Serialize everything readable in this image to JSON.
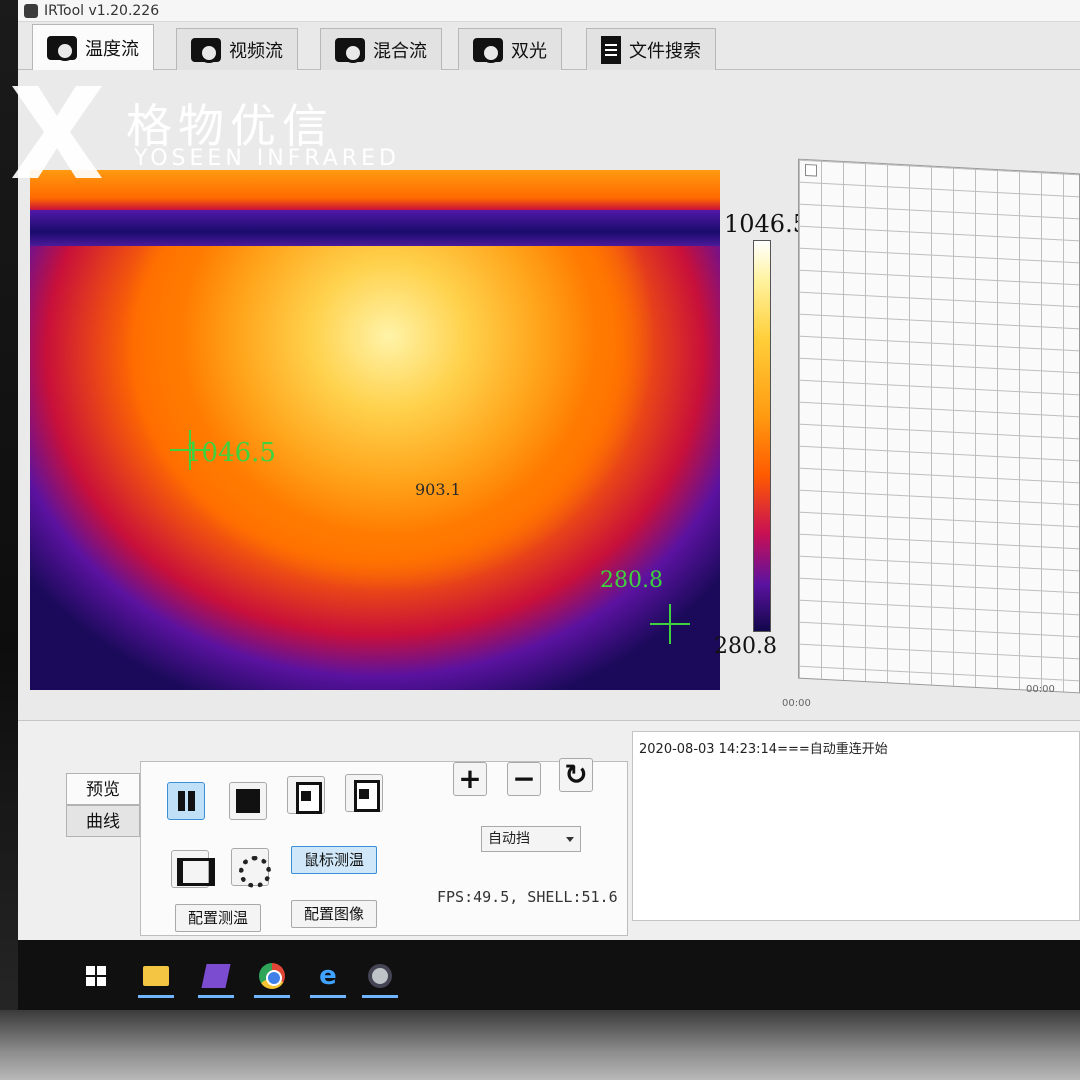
{
  "window": {
    "title": "IRTool v1.20.226"
  },
  "tabs": [
    {
      "label": "温度流",
      "icon": "camera-icon"
    },
    {
      "label": "视频流",
      "icon": "camera-icon"
    },
    {
      "label": "混合流",
      "icon": "camera-icon"
    },
    {
      "label": "双光",
      "icon": "camera-icon"
    },
    {
      "label": "文件搜索",
      "icon": "document-icon"
    }
  ],
  "watermark": {
    "brand_cn": "格物优信",
    "brand_en": "YOSEEN INFRARED"
  },
  "thermal": {
    "max_label": "1046.5",
    "center_label": "903.1",
    "min_label": "280.8",
    "colorbar_max": "1046.5",
    "colorbar_min": "280.8"
  },
  "chart": {
    "x_ticks": [
      "00:00",
      "00:00"
    ]
  },
  "side_tabs": [
    "预览",
    "曲线"
  ],
  "controls": {
    "mouse_measure_label": "鼠标测温",
    "config_measure_label": "配置测温",
    "config_image_label": "配置图像",
    "zoom_in_label": "+",
    "zoom_out_label": "−",
    "range_select_value": "自动挡",
    "status_text": "FPS:49.5, SHELL:51.6"
  },
  "log": {
    "entries": [
      "2020-08-03 14:23:14===自动重连开始"
    ]
  },
  "taskbar": {
    "items": [
      "windows-start-icon",
      "file-explorer-icon",
      "visual-studio-icon",
      "chrome-icon",
      "edge-icon",
      "irtool-app-icon"
    ],
    "accent": "#6fb4ff"
  },
  "colors": {
    "pressed_button": "#cfe7f8",
    "crosshair": "#3fd23f"
  }
}
